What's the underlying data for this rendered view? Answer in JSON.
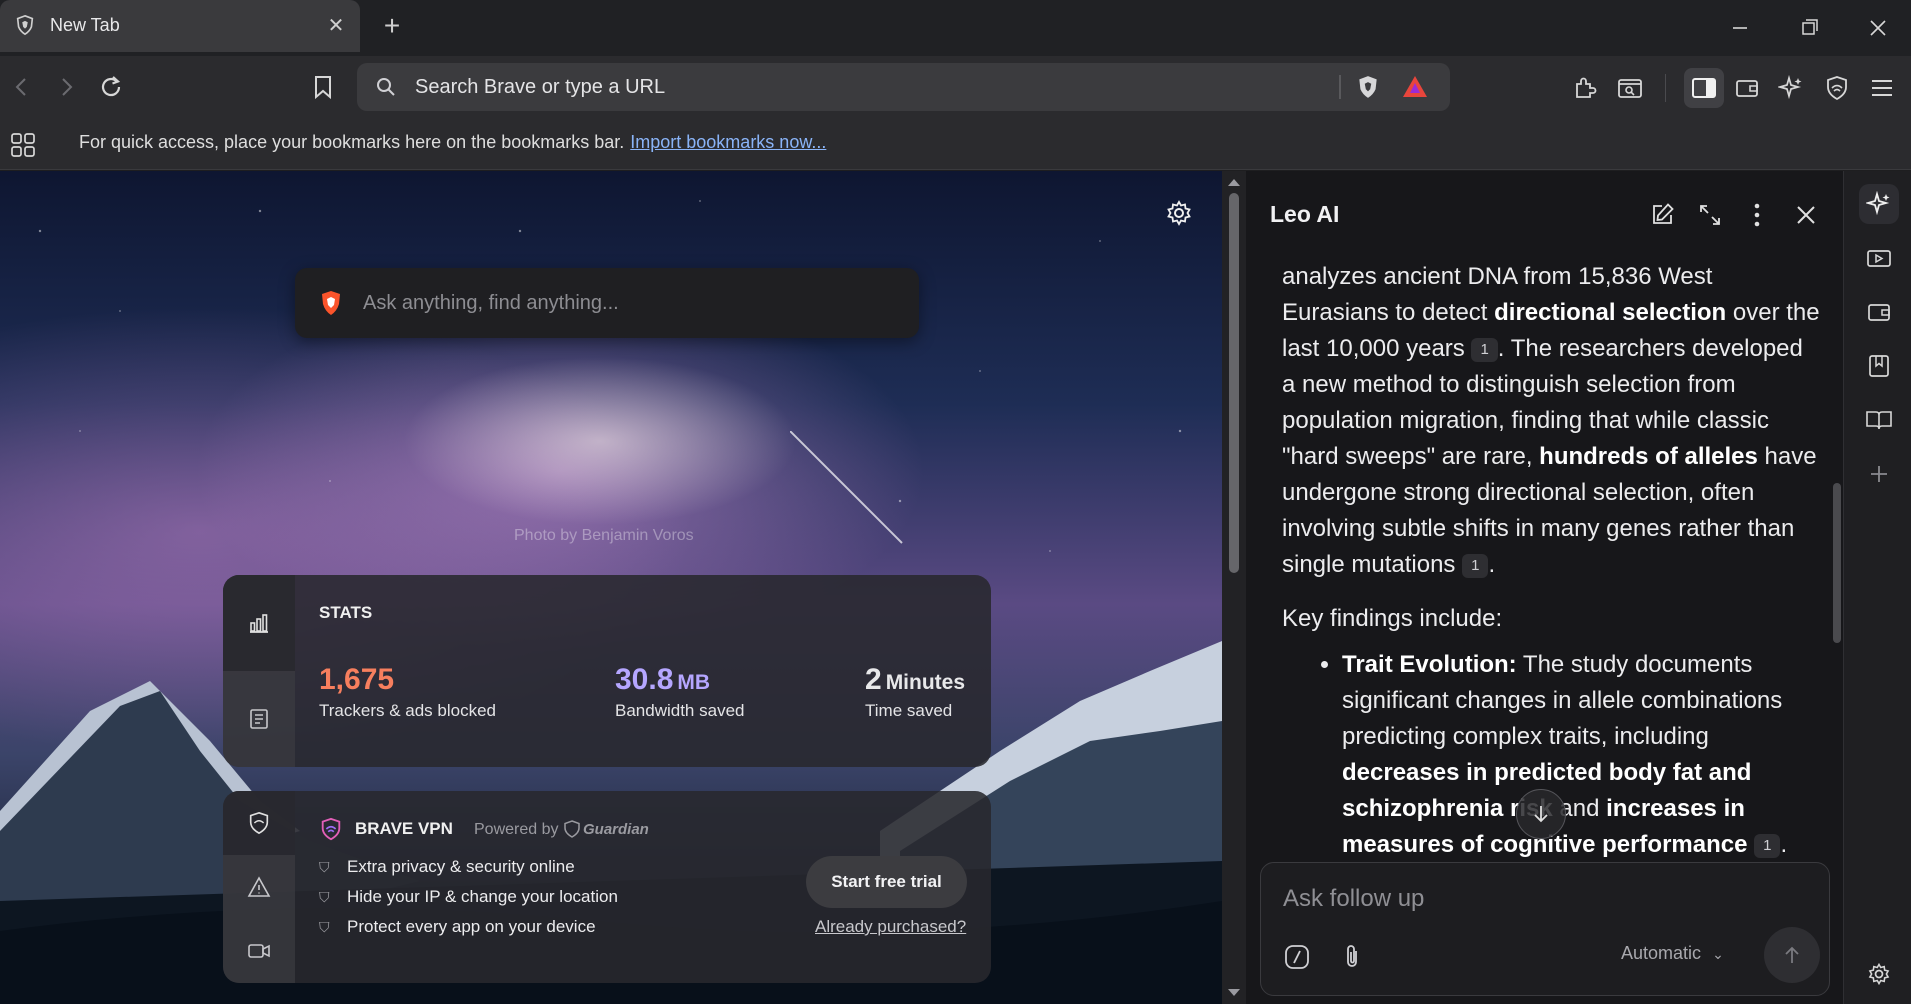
{
  "tab": {
    "title": "New Tab"
  },
  "toolbar": {
    "omnibox_placeholder": "Search Brave or type a URL"
  },
  "bookmarks_bar": {
    "message": "For quick access, place your bookmarks here on the bookmarks bar.",
    "link": "Import bookmarks now..."
  },
  "ntp": {
    "search_placeholder": "Ask anything, find anything...",
    "photo_credit": "Photo by Benjamin Voros",
    "stats": {
      "heading": "STATS",
      "trackers_value": "1,675",
      "trackers_label": "Trackers & ads blocked",
      "bandwidth_value": "30.8",
      "bandwidth_unit": "MB",
      "bandwidth_label": "Bandwidth saved",
      "time_value": "2",
      "time_unit": "Minutes",
      "time_label": "Time saved"
    },
    "vpn": {
      "title": "BRAVE VPN",
      "powered_by": "Powered by",
      "partner": "Guardian",
      "features": [
        "Extra privacy & security online",
        "Hide your IP & change your location",
        "Protect every app on your device"
      ],
      "cta": "Start free trial",
      "link": "Already purchased?"
    }
  },
  "leo": {
    "title": "Leo AI",
    "para1": {
      "t1": "analyzes ancient DNA from 15,836 West Eurasians to detect ",
      "b1": "directional selection",
      "t2": " over the last 10,000 years ",
      "c1": "1",
      "t3": ". The researchers developed a new method to distinguish selection from population migration, finding that while classic \"hard sweeps\" are rare, ",
      "b2": "hundreds of alleles",
      "t4": " have undergone strong directional selection, often involving subtle shifts in many genes rather than single mutations ",
      "c2": "1",
      "t5": "."
    },
    "para2": "Key findings include:",
    "bullet1": {
      "b1": "Trait Evolution:",
      "t1": " The study documents significant changes in allele combinations predicting complex traits, including ",
      "b2": "decreases in predicted body fat and schizophrenia risk",
      "t2": " and ",
      "b3": "increases in measures of cognitive performance",
      "t3": " ",
      "c1": "1",
      "t4": "."
    },
    "input_placeholder": "Ask follow up",
    "model": "Automatic"
  },
  "colors": {
    "trackers": "#f77f5e",
    "bandwidth": "#b5a6ff",
    "time": "#ffffff",
    "link": "#8ab4f8"
  }
}
